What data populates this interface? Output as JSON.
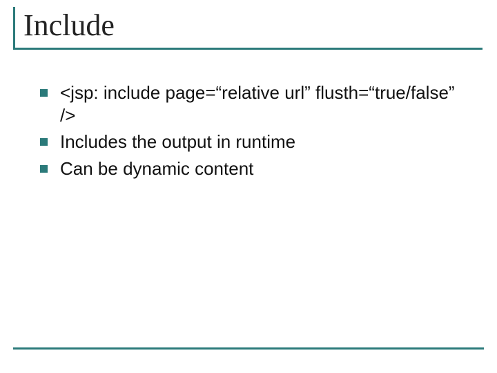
{
  "colors": {
    "accent": "#2b7a7a"
  },
  "slide": {
    "title": "Include",
    "bullets": [
      "<jsp: include page=“relative url” flusth=“true/false” />",
      "Includes the output in runtime",
      "Can be dynamic content"
    ]
  }
}
